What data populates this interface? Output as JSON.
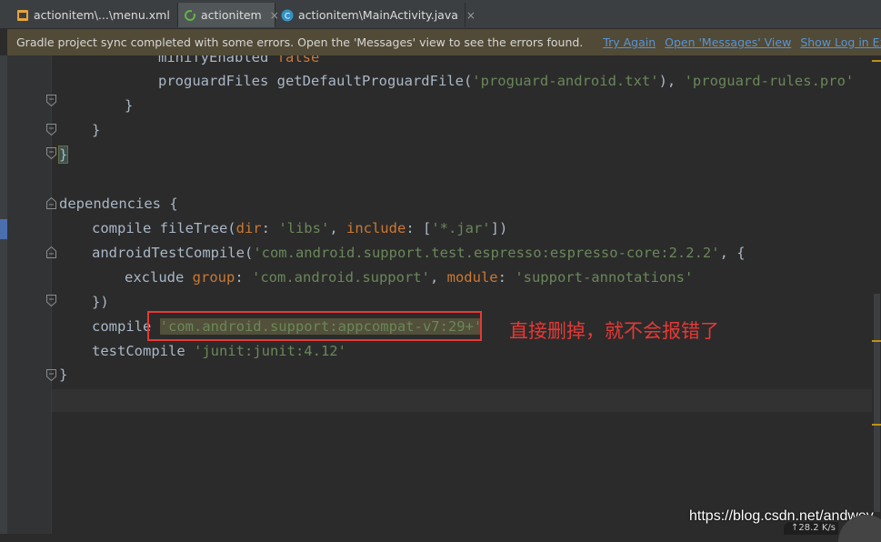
{
  "tabs": [
    {
      "label": "actionitem\\...\\menu.xml",
      "icon": "xml-layout-icon",
      "active": false
    },
    {
      "label": "actionitem",
      "icon": "gradle-sync-icon",
      "active": true
    },
    {
      "label": "actionitem\\MainActivity.java",
      "icon": "java-class-icon",
      "active": false
    }
  ],
  "tab_close_glyph": "×",
  "notification": {
    "message": "Gradle project sync completed with some errors. Open the 'Messages' view to see the errors found.",
    "links": [
      "Try Again",
      "Open 'Messages' View",
      "Show Log in Explorer"
    ]
  },
  "code": {
    "l0": {
      "a": "minifyEnabled ",
      "b": "false"
    },
    "l1": {
      "a": "proguardFiles getDefaultProguardFile(",
      "s1": "'proguard-android.txt'",
      "c": "), ",
      "s2": "'proguard-rules.pro'"
    },
    "l2": "}",
    "l3": "}",
    "l4": "}",
    "l5": "dependencies {",
    "l6": {
      "a": "compile fileTree(",
      "k1": "dir",
      "b": ": ",
      "s1": "'libs'",
      "c": ", ",
      "k2": "include",
      "d": ": [",
      "s2": "'*.jar'",
      "e": "])"
    },
    "l7": {
      "a": "androidTestCompile(",
      "s1": "'com.android.support.test.espresso:espresso-core:2.2.2'",
      "b": ", {"
    },
    "l8": {
      "a": "exclude ",
      "k1": "group",
      "b": ": ",
      "s1": "'com.android.support'",
      "c": ", ",
      "k2": "module",
      "d": ": ",
      "s2": "'support-annotations'"
    },
    "l9": "})",
    "l10": {
      "a": "compile ",
      "s1": "'com.android.support:appcompat-v7:29+'"
    },
    "l11": {
      "a": "testCompile ",
      "s1": "'junit:junit:4.12'"
    },
    "l12": "}"
  },
  "annotation_note": "直接删掉，就不会报错了",
  "watermark": "https://blog.csdn.net/andwey",
  "net_speed": "↑28.2 K/s",
  "colors": {
    "keyword": "#a9b7c6",
    "named_arg": "#cc7832",
    "string": "#6a8759",
    "annotation_red": "#e53935",
    "link": "#5894d6"
  }
}
